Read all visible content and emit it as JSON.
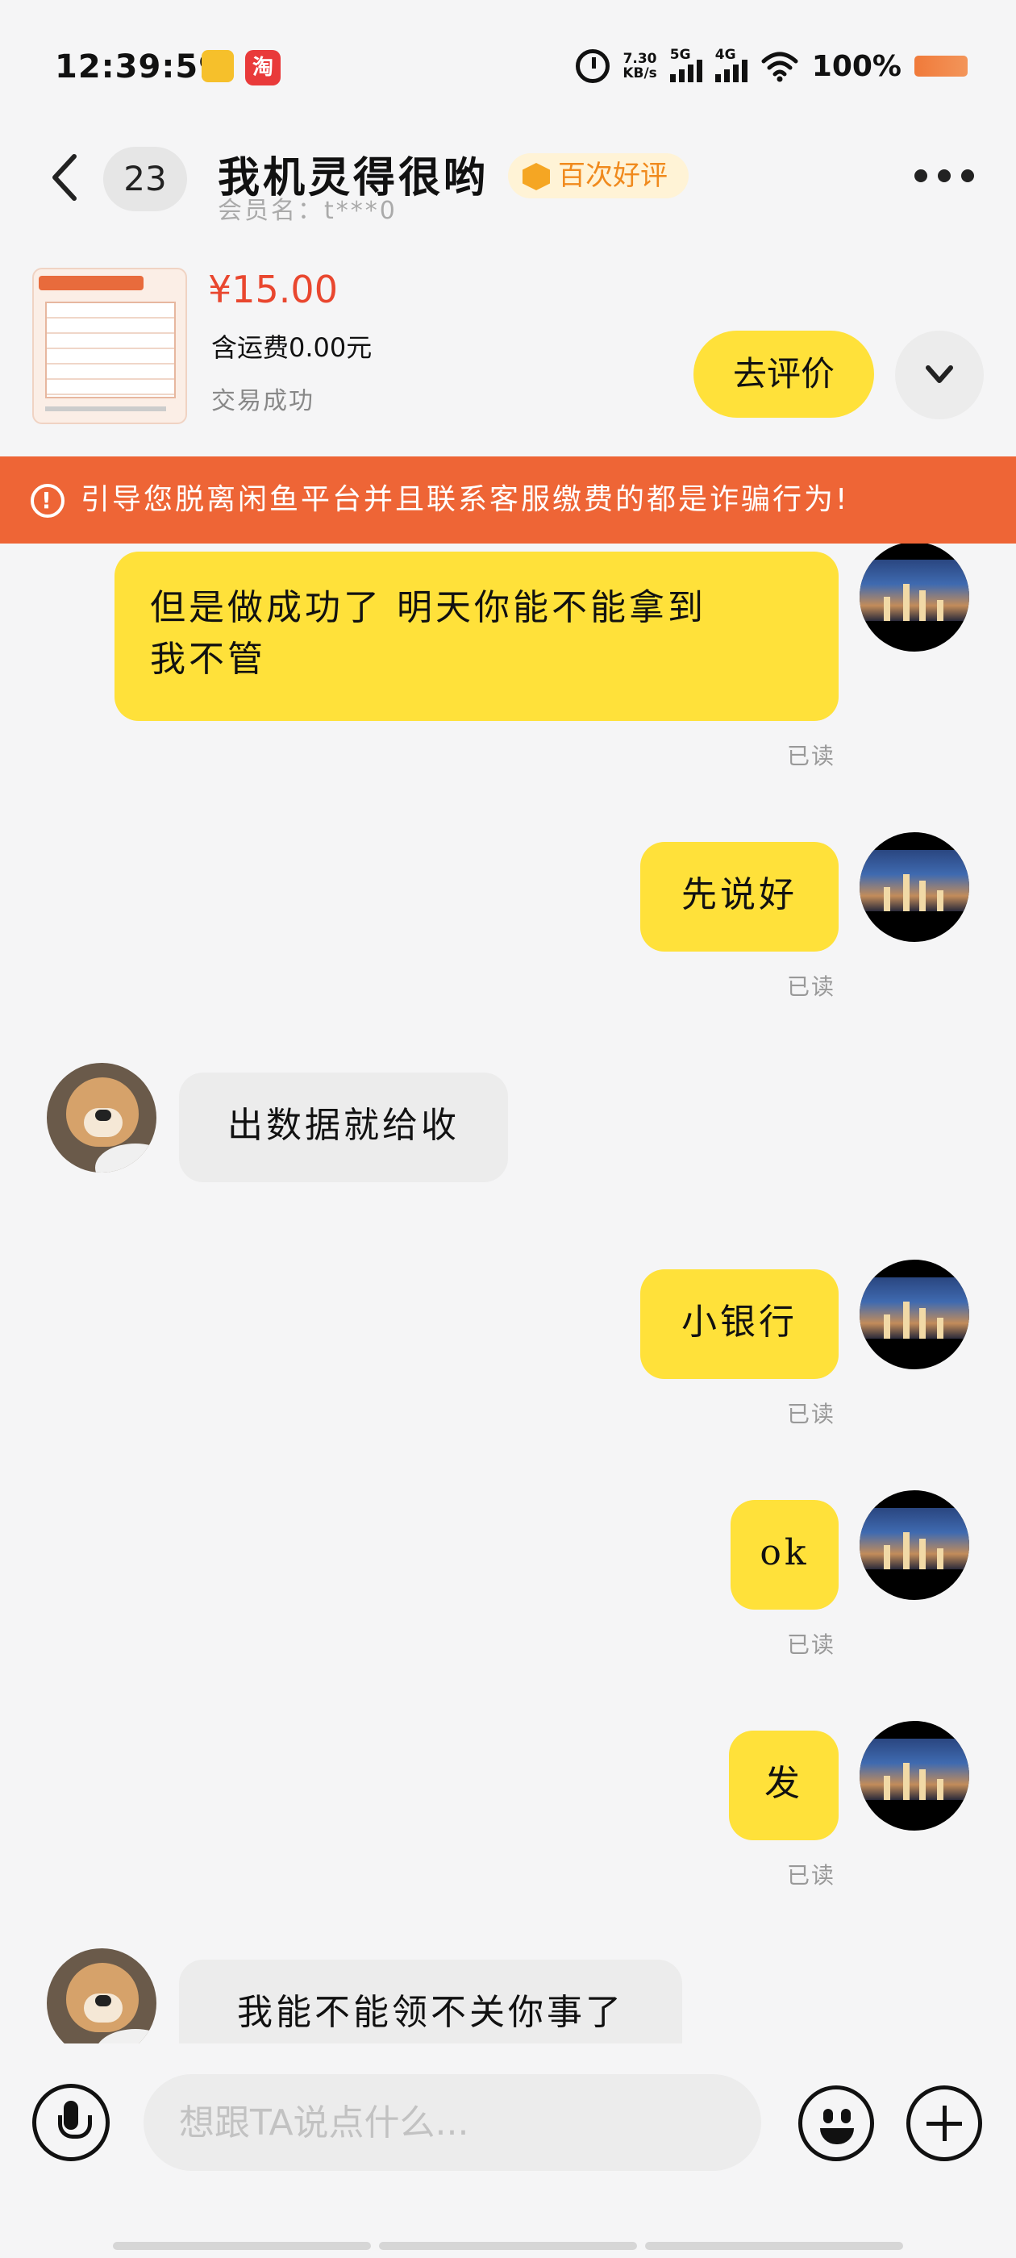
{
  "status_bar": {
    "time": "12:39:59",
    "app_badge": "淘",
    "net_speed_value": "7.30",
    "net_speed_unit": "KB/s",
    "sim1": "5G",
    "sim2": "4G",
    "battery": "100%"
  },
  "header": {
    "unread_count": "23",
    "shop_name": "我机灵得很哟",
    "badge": "百次好评",
    "member": "会员名：t***0"
  },
  "product": {
    "price": "¥15.00",
    "shipping": "含运费0.00元",
    "status": "交易成功",
    "review_button": "去评价"
  },
  "warning": {
    "text": "引导您脱离闲鱼平台并且联系客服缴费的都是诈骗行为!"
  },
  "messages": [
    {
      "side": "out",
      "line1": "但是做成功了 明天你能不能拿到",
      "line2": "我不管",
      "read": "已读"
    },
    {
      "side": "out",
      "text": "先说好",
      "read": "已读"
    },
    {
      "side": "in",
      "text": "出数据就给收"
    },
    {
      "side": "out",
      "text": "小银行",
      "read": "已读"
    },
    {
      "side": "out",
      "text": "ok",
      "read": "已读"
    },
    {
      "side": "out",
      "text": "发",
      "read": "已读"
    },
    {
      "side": "in",
      "text": "我能不能领不关你事了"
    }
  ],
  "input": {
    "placeholder": "想跟TA说点什么..."
  },
  "icons": {
    "back": "chevron-left-icon",
    "more": "more-dots-icon",
    "expand": "chevron-down-icon",
    "warning": "alert-circle-icon",
    "mic": "microphone-icon",
    "emoji": "emoji-icon",
    "plus": "plus-icon"
  },
  "colors": {
    "accent_yellow": "#ffe13a",
    "warning_orange": "#ee6536",
    "price_red": "#e9472f"
  }
}
